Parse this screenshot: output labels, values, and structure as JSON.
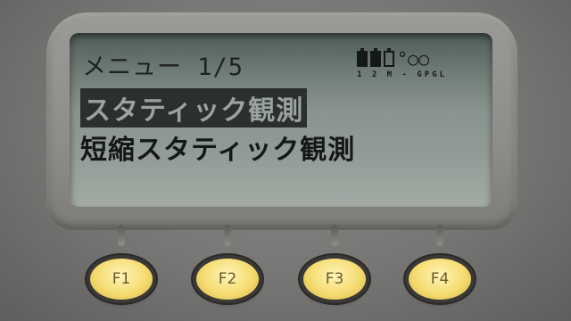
{
  "screen": {
    "menu_title": "メニュー  1/5",
    "items": [
      {
        "label": "スタティック観測",
        "selected": true
      },
      {
        "label": "短縮スタティック観測",
        "selected": false
      }
    ],
    "status": {
      "battery_icons": [
        "battery-full-icon",
        "battery-full-icon",
        "battery-empty-icon"
      ],
      "signal_icon": "radio-signal-icon",
      "labels": "1 2 M - GPGL"
    }
  },
  "function_keys": [
    {
      "label": "F1"
    },
    {
      "label": "F2"
    },
    {
      "label": "F3"
    },
    {
      "label": "F4"
    }
  ],
  "colors": {
    "lcd_background": "#8a948f",
    "lcd_text": "#141816",
    "selection_background": "#2b302e",
    "key_yellow": "#f5dc72"
  }
}
